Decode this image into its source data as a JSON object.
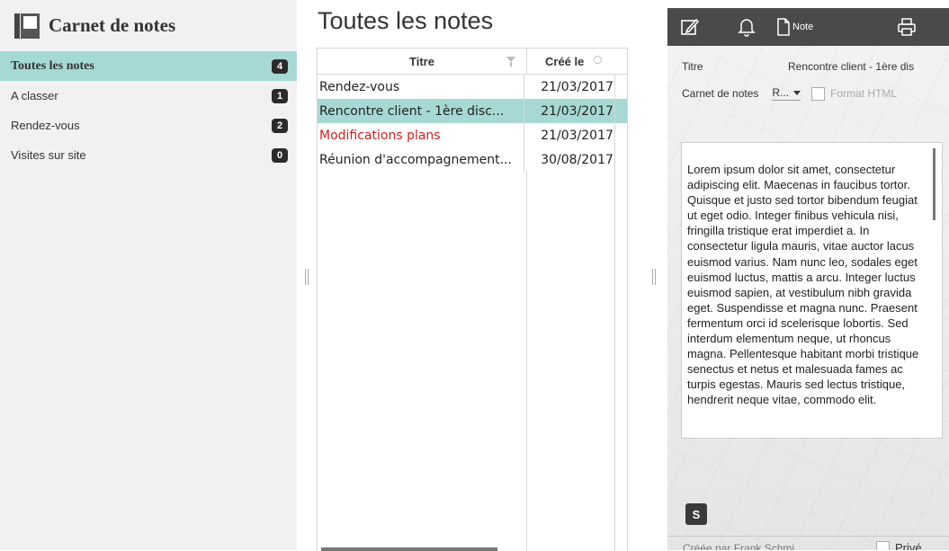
{
  "sidebar": {
    "title": "Carnet de notes",
    "items": [
      {
        "label": "Toutes les notes",
        "count": "4"
      },
      {
        "label": "A classer",
        "count": "1"
      },
      {
        "label": "Rendez-vous",
        "count": "2"
      },
      {
        "label": "Visites sur site",
        "count": "0"
      }
    ]
  },
  "list": {
    "title": "Toutes les notes",
    "columns": {
      "title": "Titre",
      "created": "Créé le"
    },
    "rows": [
      {
        "title": "Rendez-vous",
        "date": "21/03/2017"
      },
      {
        "title": "Rencontre client - 1ère disc...",
        "date": "21/03/2017"
      },
      {
        "title": "Modifications plans",
        "date": "21/03/2017"
      },
      {
        "title": "Réunion d'accompagnement...",
        "date": "30/08/2017"
      }
    ]
  },
  "editor": {
    "toolbar": {
      "note_label": "Note"
    },
    "title_label": "Titre",
    "title_value": "Rencontre client - 1ère dis",
    "notebook_label": "Carnet de notes",
    "notebook_value": "R...",
    "format_html_label": "Format HTML",
    "body": "Lorem ipsum dolor sit amet, consectetur adipiscing elit. Maecenas in faucibus tortor. Quisque et justo sed tortor bibendum feugiat ut eget odio. Integer finibus vehicula nisi, fringilla tristique erat imperdiet a. In consectetur ligula mauris, vitae auctor lacus euismod varius. Nam nunc leo, sodales eget euismod luctus, mattis a arcu. Integer luctus euismod sapien, at vestibulum nibh gravida eget. Suspendisse et magna nunc. Praesent fermentum orci id scelerisque lobortis. Sed interdum elementum neque, ut rhoncus magna. Pellentesque habitant morbi tristique senectus et netus et malesuada fames ac turpis egestas. Mauris sed lectus tristique, hendrerit neque vitae, commodo elit.",
    "s_badge": "S",
    "created_by": "Créée par Frank Schmi...",
    "private_label": "Privé"
  },
  "colors": {
    "selection": "#a6d9d4",
    "toolbar": "#4a4a4a",
    "red_note": "#d02020",
    "badge": "#2b2b2b"
  },
  "icons": [
    "notebook-icon",
    "edit-icon",
    "bell-icon",
    "note-page-icon",
    "print-icon",
    "filter-icon",
    "search-icon"
  ]
}
